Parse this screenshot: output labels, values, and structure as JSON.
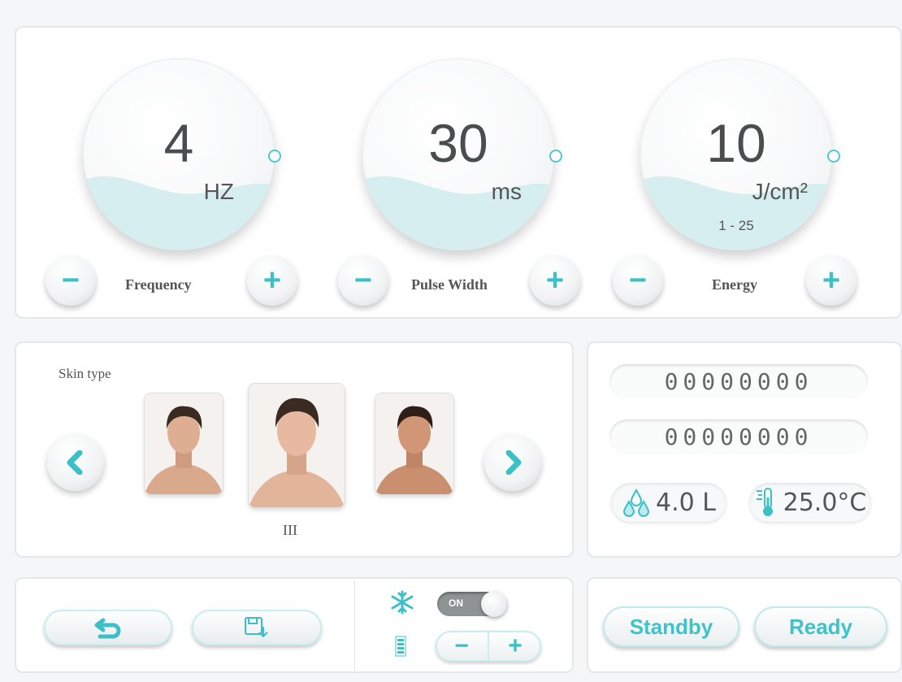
{
  "dials": [
    {
      "label": "Frequency",
      "value": "4",
      "unit": "HZ",
      "range": ""
    },
    {
      "label": "Pulse Width",
      "value": "30",
      "unit": "ms",
      "range": ""
    },
    {
      "label": "Energy",
      "value": "10",
      "unit": "J/cm²",
      "range": "1 - 25"
    }
  ],
  "controls": {
    "minus": "−",
    "plus": "+"
  },
  "skin": {
    "title": "Skin type",
    "selected": "III",
    "prev_icon": "chevron-left-icon",
    "next_icon": "chevron-right-icon"
  },
  "stats": {
    "counter1": "00000000",
    "counter2": "00000000",
    "water": "4.0 L",
    "temperature": "25.0°C"
  },
  "bottom": {
    "back_icon": "back-arrow-icon",
    "save_icon": "save-icon",
    "cooling_icon": "snowflake-icon",
    "cooling_toggle": "ON",
    "level_icon": "level-bars-icon",
    "minus": "−",
    "plus": "+"
  },
  "states": {
    "standby": "Standby",
    "ready": "Ready"
  },
  "colors": {
    "accent": "#3fc3c9",
    "ring": "#7fd4d8"
  }
}
